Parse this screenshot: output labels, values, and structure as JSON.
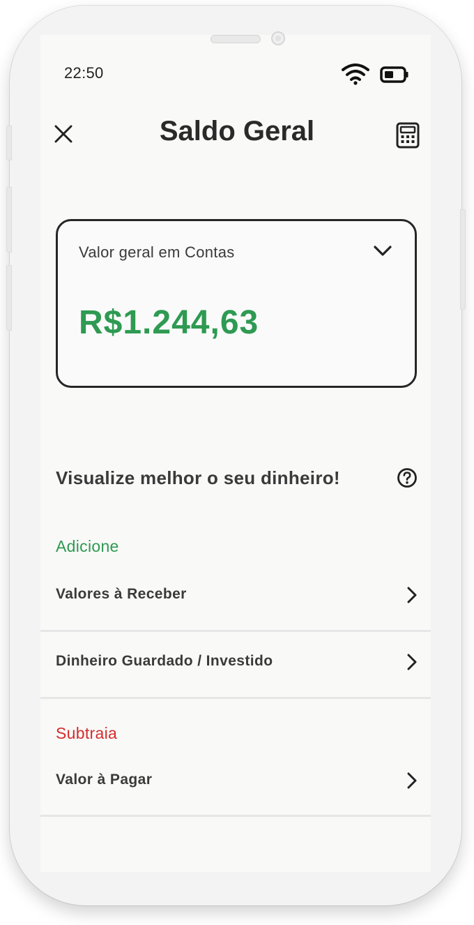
{
  "status_bar": {
    "time": "22:50",
    "wifi_icon": "wifi-icon",
    "battery_icon": "battery-icon"
  },
  "header": {
    "title": "Saldo Geral",
    "close_icon": "close-icon",
    "calculator_icon": "calculator-icon"
  },
  "balance_card": {
    "label": "Valor geral em Contas",
    "value": "R$1.244,63",
    "chevron_icon": "chevron-down-icon"
  },
  "section": {
    "heading": "Visualize melhor o seu dinheiro!",
    "help_icon": "help-circle-icon"
  },
  "groups": {
    "add": {
      "label": "Adicione",
      "color": "#2e9a52"
    },
    "subtract": {
      "label": "Subtraia",
      "color": "#d62c2c"
    }
  },
  "items": [
    {
      "label": "Valores à Receber"
    },
    {
      "label": "Dinheiro Guardado / Investido"
    },
    {
      "label": "Valor à Pagar"
    }
  ],
  "colors": {
    "accent_green": "#2e9a52",
    "accent_red": "#d62c2c",
    "text_dark": "#2a2a2a"
  }
}
